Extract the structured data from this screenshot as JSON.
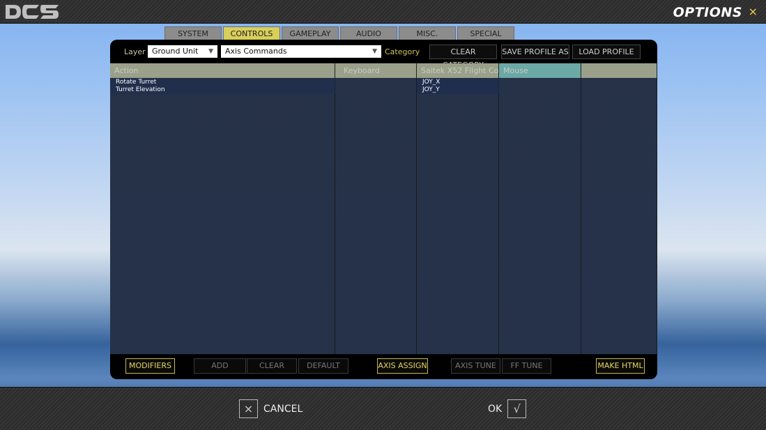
{
  "header": {
    "logo_text": "DCS",
    "title": "OPTIONS",
    "close_glyph": "×"
  },
  "tabs": [
    {
      "label": "SYSTEM",
      "active": false
    },
    {
      "label": "CONTROLS",
      "active": true
    },
    {
      "label": "GAMEPLAY",
      "active": false
    },
    {
      "label": "AUDIO",
      "active": false
    },
    {
      "label": "MISC.",
      "active": false
    },
    {
      "label": "SPECIAL",
      "active": false
    }
  ],
  "toolbar": {
    "layer_label": "Layer",
    "layer_value": "Ground Unit",
    "category_value": "Axis Commands",
    "category_label": "Category",
    "clear_category": "CLEAR CATEGORY",
    "save_profile": "SAVE PROFILE AS",
    "load_profile": "LOAD PROFILE"
  },
  "grid": {
    "columns": [
      "Action",
      "Keyboard",
      "Saitek X52 Flight Co",
      "Mouse",
      ""
    ],
    "rows": [
      {
        "action": "Rotate Turret",
        "keyboard": "",
        "joystick": "JOY_X",
        "mouse": ""
      },
      {
        "action": "Turret Elevation",
        "keyboard": "",
        "joystick": "JOY_Y",
        "mouse": ""
      }
    ]
  },
  "actions": {
    "modifiers": "MODIFIERS",
    "add": "ADD",
    "clear": "CLEAR",
    "default": "DEFAULT",
    "axis_assign": "AXIS ASSIGN",
    "axis_tune": "AXIS TUNE",
    "ff_tune": "FF TUNE",
    "make_html": "MAKE HTML"
  },
  "footer": {
    "cancel_label": "CANCEL",
    "cancel_glyph": "×",
    "ok_label": "OK",
    "ok_glyph": "√"
  },
  "colors": {
    "accent": "#d8ce5a",
    "mouse_column": "#6ba8a6",
    "header_column": "#9aa08a",
    "tab_inactive": "#8c8c8c"
  }
}
